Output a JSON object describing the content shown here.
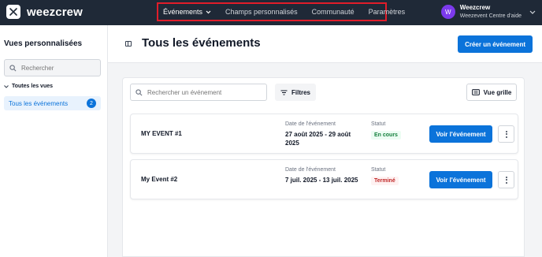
{
  "app": {
    "name": "weezcrew"
  },
  "nav": {
    "items": [
      {
        "label": "Événements",
        "active": true
      },
      {
        "label": "Champs personnalisés",
        "active": false
      },
      {
        "label": "Communauté",
        "active": false
      },
      {
        "label": "Paramètres",
        "active": false
      }
    ]
  },
  "user": {
    "initial": "W",
    "name": "Weezcrew",
    "subtitle": "Weezevent Centre d'aide"
  },
  "sidebar": {
    "title": "Vues personnalisées",
    "search_placeholder": "Rechercher",
    "group_label": "Toutes les vues",
    "items": [
      {
        "label": "Tous les événements",
        "count": "2"
      }
    ]
  },
  "header": {
    "title": "Tous les événements",
    "create_button": "Créer un événement"
  },
  "toolbar": {
    "search_placeholder": "Rechercher un événement",
    "filters_label": "Filtres",
    "grid_view_label": "Vue grille"
  },
  "events": [
    {
      "name": "MY EVENT #1",
      "date_label": "Date de l'événement",
      "date": "27 août 2025 - 29 août 2025",
      "status_label": "Statut",
      "status": "En cours",
      "button": "Voir l'événement"
    },
    {
      "name": "My Event #2",
      "date_label": "Date de l'événement",
      "date": "7 juil. 2025 - 13 juil. 2025",
      "status_label": "Statut",
      "status": "Terminé",
      "button": "Voir l'événement"
    }
  ],
  "colors": {
    "topbar": "#1f2937",
    "accent": "#0b73da",
    "highlight_border": "#e11d2a",
    "status_ongoing": "#15803d",
    "status_ended": "#c02626"
  }
}
